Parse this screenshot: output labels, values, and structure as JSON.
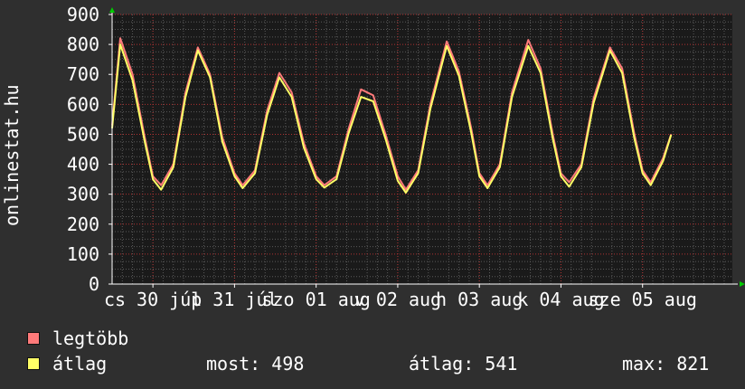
{
  "watermark": "onlinestat.hu",
  "legend": {
    "max": {
      "label": "legtöbb",
      "color": "#ff7a7a"
    },
    "avg": {
      "label": "átlag",
      "color": "#ffff66"
    }
  },
  "stats": {
    "now": "most: 498",
    "avg": "átlag: 541",
    "max": "max: 821"
  },
  "colors": {
    "background": "#2f2f2f",
    "plot_background": "#1a1a1a",
    "grid_minor": "#5a5a5a",
    "grid_major": "#b03030",
    "axis": "#ffffff",
    "arrow": "#00cc00"
  },
  "chart_data": {
    "type": "line",
    "ylim": [
      0,
      900
    ],
    "yticks": [
      "0",
      "100",
      "200",
      "300",
      "400",
      "500",
      "600",
      "700",
      "800",
      "900"
    ],
    "xticks": [
      "cs 30 júl",
      "p 31 júl",
      "szo 01 aug",
      "v 02 aug",
      "h 03 aug",
      "k 04 aug",
      "sze 05 aug"
    ],
    "x_range_days": [
      0,
      7.6
    ],
    "xtick_positions_days": [
      0,
      1,
      2,
      3,
      4,
      5,
      6
    ],
    "daily_peaks": [
      {
        "day": 0.1,
        "max": 821,
        "avg": 800
      },
      {
        "day": 1.05,
        "max": 790,
        "avg": 780
      },
      {
        "day": 2.05,
        "max": 705,
        "avg": 690
      },
      {
        "day": 3.05,
        "max": 650,
        "avg": 625
      },
      {
        "day": 4.1,
        "max": 810,
        "avg": 795
      },
      {
        "day": 5.1,
        "max": 815,
        "avg": 795
      },
      {
        "day": 6.1,
        "max": 790,
        "avg": 780
      }
    ],
    "daily_troughs": [
      {
        "day": 0.6,
        "max": 330,
        "avg": 315
      },
      {
        "day": 1.6,
        "max": 330,
        "avg": 320
      },
      {
        "day": 2.6,
        "max": 330,
        "avg": 322
      },
      {
        "day": 3.6,
        "max": 315,
        "avg": 305
      },
      {
        "day": 4.6,
        "max": 330,
        "avg": 320
      },
      {
        "day": 5.6,
        "max": 340,
        "avg": 325
      },
      {
        "day": 6.6,
        "max": 340,
        "avg": 330
      }
    ],
    "series": [
      {
        "name": "legtöbb",
        "color": "#ff7a7a",
        "x": [
          0.0,
          0.1,
          0.25,
          0.4,
          0.5,
          0.6,
          0.75,
          0.9,
          1.05,
          1.2,
          1.35,
          1.5,
          1.6,
          1.75,
          1.9,
          2.05,
          2.2,
          2.35,
          2.5,
          2.6,
          2.75,
          2.9,
          3.05,
          3.2,
          3.35,
          3.5,
          3.6,
          3.75,
          3.9,
          4.1,
          4.25,
          4.4,
          4.5,
          4.6,
          4.75,
          4.9,
          5.1,
          5.25,
          5.4,
          5.5,
          5.6,
          5.75,
          5.9,
          6.1,
          6.25,
          6.4,
          6.5,
          6.6,
          6.75,
          6.85
        ],
        "values": [
          530,
          821,
          700,
          490,
          360,
          330,
          400,
          640,
          790,
          700,
          490,
          370,
          330,
          380,
          580,
          705,
          640,
          470,
          360,
          330,
          360,
          520,
          650,
          630,
          500,
          360,
          315,
          380,
          600,
          810,
          710,
          520,
          370,
          330,
          400,
          640,
          815,
          720,
          500,
          370,
          340,
          400,
          620,
          790,
          720,
          500,
          380,
          340,
          420,
          500
        ]
      },
      {
        "name": "átlag",
        "color": "#ffff66",
        "x": [
          0.0,
          0.1,
          0.25,
          0.4,
          0.5,
          0.6,
          0.75,
          0.9,
          1.05,
          1.2,
          1.35,
          1.5,
          1.6,
          1.75,
          1.9,
          2.05,
          2.2,
          2.35,
          2.5,
          2.6,
          2.75,
          2.9,
          3.05,
          3.2,
          3.35,
          3.5,
          3.6,
          3.75,
          3.9,
          4.1,
          4.25,
          4.4,
          4.5,
          4.6,
          4.75,
          4.9,
          5.1,
          5.25,
          5.4,
          5.5,
          5.6,
          5.75,
          5.9,
          6.1,
          6.25,
          6.4,
          6.5,
          6.6,
          6.75,
          6.85
        ],
        "values": [
          520,
          800,
          680,
          475,
          350,
          315,
          390,
          625,
          780,
          690,
          475,
          360,
          320,
          370,
          565,
          690,
          625,
          455,
          350,
          322,
          350,
          505,
          625,
          610,
          485,
          345,
          305,
          370,
          585,
          795,
          695,
          505,
          360,
          320,
          390,
          625,
          795,
          705,
          485,
          360,
          325,
          390,
          605,
          780,
          705,
          485,
          370,
          330,
          410,
          498
        ]
      }
    ]
  }
}
